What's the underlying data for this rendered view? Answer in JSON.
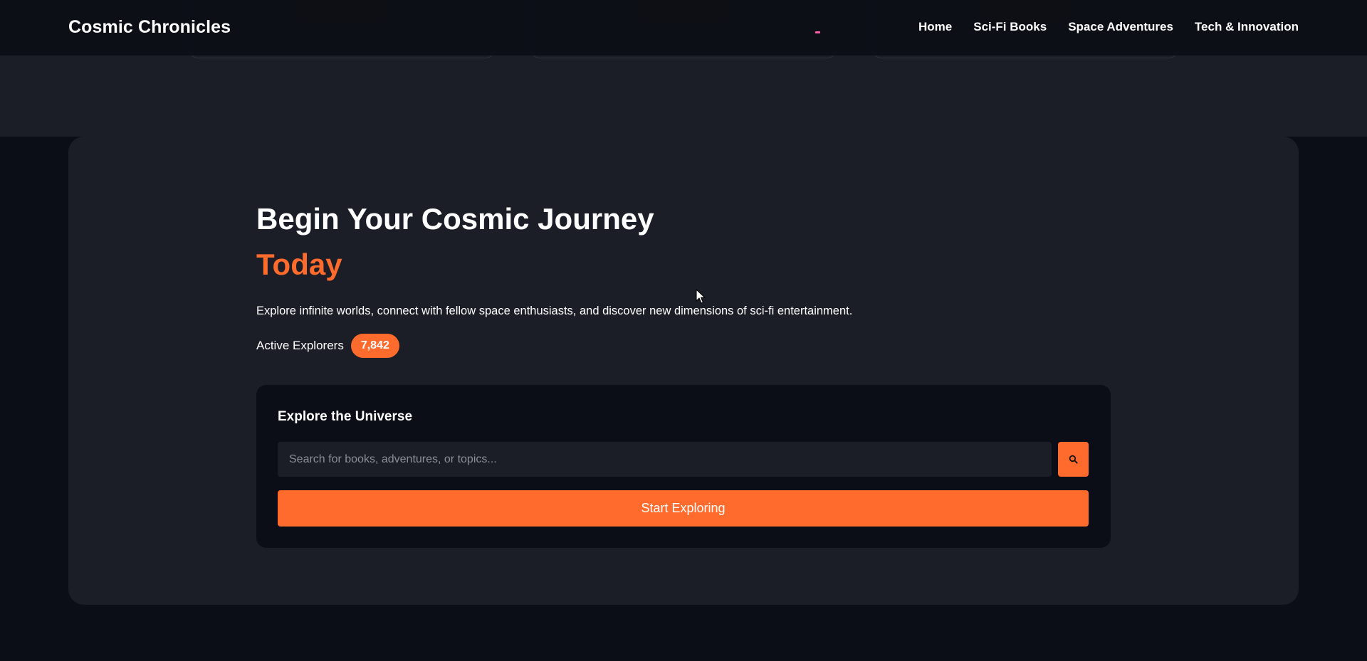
{
  "header": {
    "logo": "Cosmic Chronicles",
    "nav": [
      "Home",
      "Sci-Fi Books",
      "Space Adventures",
      "Tech & Innovation"
    ]
  },
  "hero": {
    "title": "Begin Your Cosmic Journey",
    "title_accent": "Today",
    "description": "Explore infinite worlds, connect with fellow space enthusiasts, and discover new dimensions of sci-fi entertainment.",
    "stat_label": "Active Explorers",
    "stat_value": "7,842"
  },
  "search": {
    "title": "Explore the Universe",
    "placeholder": "Search for books, adventures, or topics...",
    "search_icon": "search-icon",
    "cta": "Start Exploring"
  },
  "colors": {
    "accent": "#ff6b2c",
    "page_bg": "#0b0e16",
    "panel_bg": "#1b1e27"
  }
}
